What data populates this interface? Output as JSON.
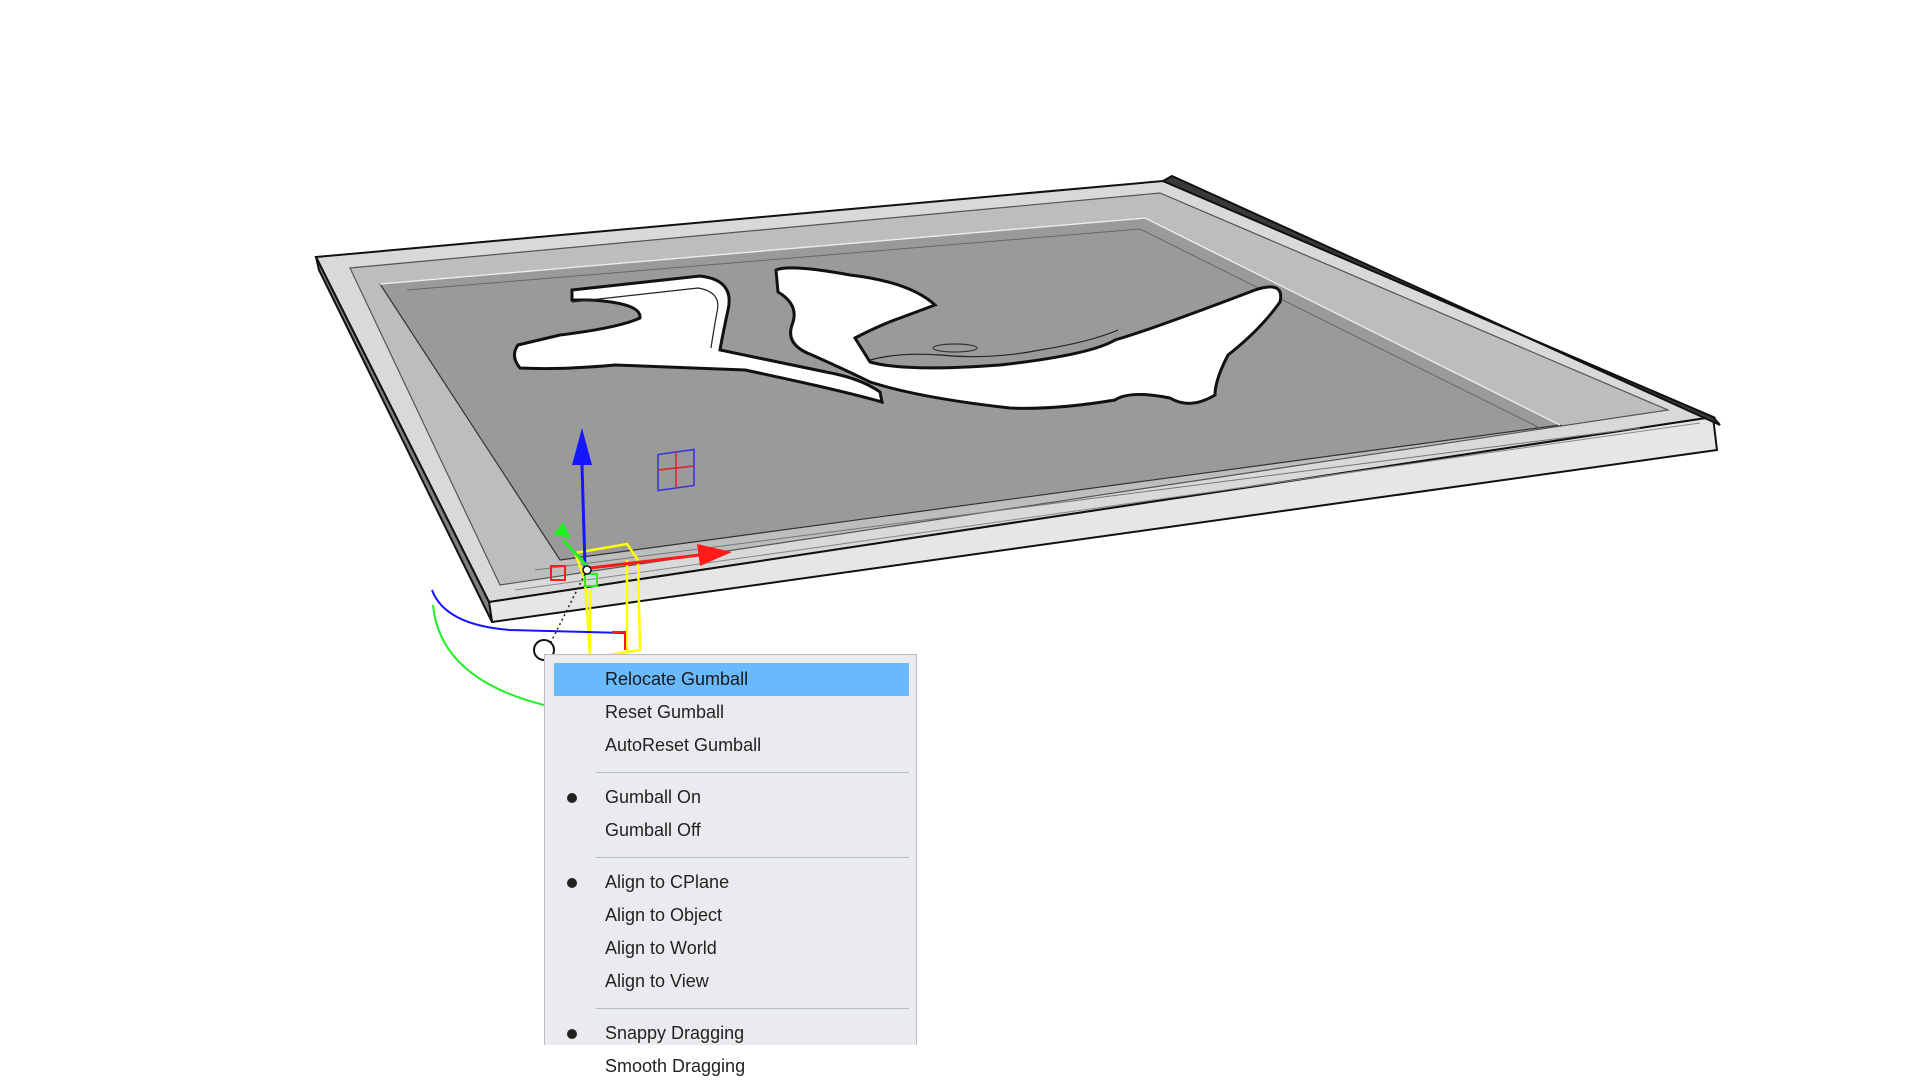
{
  "context_menu": {
    "groups": [
      {
        "items": [
          {
            "label": "Relocate Gumball",
            "checked": false,
            "highlighted": true
          },
          {
            "label": "Reset Gumball",
            "checked": false,
            "highlighted": false
          },
          {
            "label": "AutoReset Gumball",
            "checked": false,
            "highlighted": false
          }
        ]
      },
      {
        "items": [
          {
            "label": "Gumball On",
            "checked": true,
            "highlighted": false
          },
          {
            "label": "Gumball Off",
            "checked": false,
            "highlighted": false
          }
        ]
      },
      {
        "items": [
          {
            "label": "Align to CPlane",
            "checked": true,
            "highlighted": false
          },
          {
            "label": "Align to Object",
            "checked": false,
            "highlighted": false
          },
          {
            "label": "Align to World",
            "checked": false,
            "highlighted": false
          },
          {
            "label": "Align to View",
            "checked": false,
            "highlighted": false
          }
        ]
      },
      {
        "items": [
          {
            "label": "Snappy Dragging",
            "checked": true,
            "highlighted": false
          },
          {
            "label": "Smooth Dragging",
            "checked": false,
            "highlighted": false
          }
        ]
      }
    ],
    "highlight_color": "#69b9fc",
    "background_color": "#e9ebee"
  },
  "viewport": {
    "background_color": "#ffffff",
    "panel_color": "#9a9a9a",
    "gumball": {
      "x_axis_color": "#ff1a1a",
      "y_axis_color": "#22ee22",
      "z_axis_color": "#1515ff",
      "selection_color": "#ffff00"
    }
  }
}
